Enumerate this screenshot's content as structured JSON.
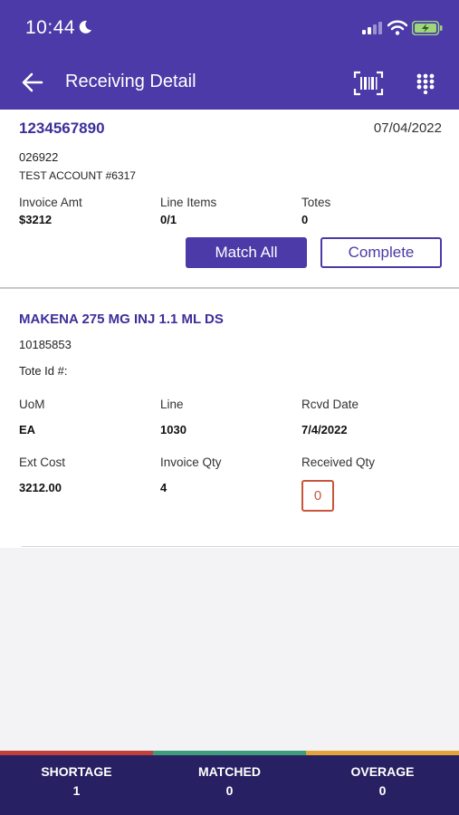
{
  "status_bar": {
    "time": "10:44"
  },
  "header": {
    "title": "Receiving Detail"
  },
  "invoice": {
    "number": "1234567890",
    "date": "07/04/2022",
    "account_number": "026922",
    "account_name": "TEST ACCOUNT #6317",
    "invoice_amt_label": "Invoice Amt",
    "invoice_amt": "$3212",
    "line_items_label": "Line Items",
    "line_items": "0/1",
    "totes_label": "Totes",
    "totes": "0",
    "match_all_label": "Match All",
    "complete_label": "Complete"
  },
  "line_item": {
    "name": "MAKENA 275 MG INJ 1.1 ML DS",
    "code": "10185853",
    "tote_label": "Tote Id #:",
    "uom_label": "UoM",
    "uom": "EA",
    "line_label": "Line",
    "line": "1030",
    "rcvd_date_label": "Rcvd Date",
    "rcvd_date": "7/4/2022",
    "ext_cost_label": "Ext Cost",
    "ext_cost": "3212.00",
    "invoice_qty_label": "Invoice Qty",
    "invoice_qty": "4",
    "received_qty_label": "Received Qty",
    "received_qty": "0"
  },
  "summary": {
    "shortage_label": "SHORTAGE",
    "shortage": "1",
    "matched_label": "MATCHED",
    "matched": "0",
    "overage_label": "OVERAGE",
    "overage": "0"
  },
  "colors": {
    "brand": "#4b3aa7",
    "summary_bg": "#272163",
    "shortage_stripe": "#c2403a",
    "matched_stripe": "#3e9c7c",
    "overage_stripe": "#e3a23a",
    "qty_border": "#c8553c"
  },
  "icons": [
    "moon-icon",
    "signal-icon",
    "wifi-icon",
    "battery-icon",
    "back-arrow-icon",
    "barcode-scan-icon",
    "keypad-icon"
  ]
}
